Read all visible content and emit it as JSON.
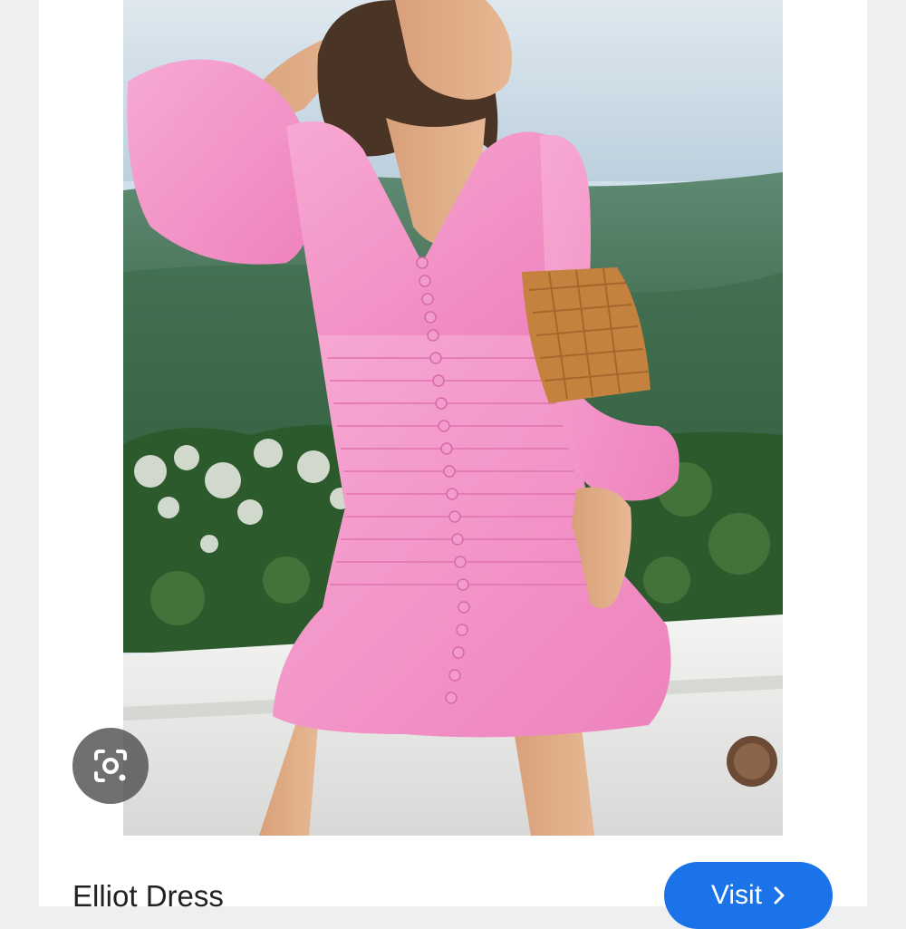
{
  "result": {
    "title": "Elliot Dress",
    "visit_label": "Visit",
    "image_icon": "product-photo",
    "lens_icon": "google-lens-icon",
    "visit_icon": "chevron-right-icon"
  },
  "colors": {
    "background": "#eeeff1",
    "card": "#ffffff",
    "visit_button": "#1a73e8",
    "lens_button": "#505050",
    "dress_pink": "#f28fc4"
  }
}
